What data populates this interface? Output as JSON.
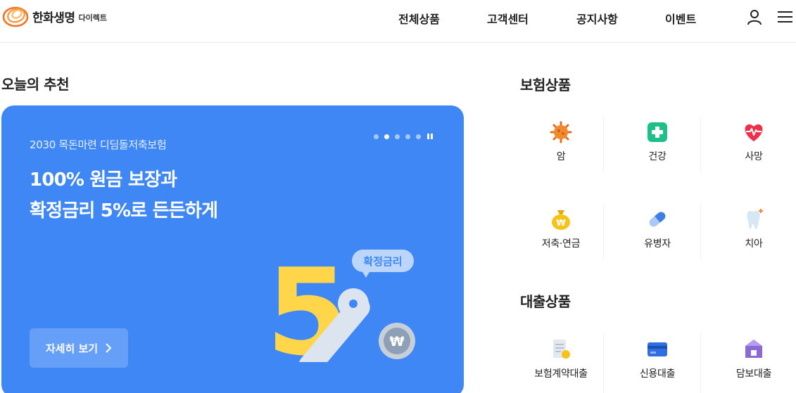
{
  "header": {
    "logo": {
      "name": "한화생명",
      "sub": "다이렉트"
    },
    "nav": [
      {
        "label": "전체상품"
      },
      {
        "label": "고객센터"
      },
      {
        "label": "공지사항"
      },
      {
        "label": "이벤트"
      }
    ],
    "icons": {
      "user": "user-icon",
      "menu": "hamburger-menu-icon"
    }
  },
  "recommend": {
    "title": "오늘의 추천",
    "banner": {
      "subtitle": "2030 목돈마련 디딤돌저축보험",
      "headline": "100% 원금 보장과\n확정금리 5%로 든든하게",
      "slides": {
        "total": 6,
        "active": 2
      },
      "promo": {
        "bubble": "확정금리",
        "number": "5",
        "percent": "%",
        "coin": "₩"
      },
      "cta": "자세히 보기",
      "color": "#3f87f5"
    }
  },
  "insurance": {
    "title": "보험상품",
    "items": [
      {
        "label": "암",
        "icon": "virus-icon"
      },
      {
        "label": "건강",
        "icon": "medical-cross-icon"
      },
      {
        "label": "사망",
        "icon": "heartbeat-icon"
      },
      {
        "label": "저축·연금",
        "icon": "money-bag-icon"
      },
      {
        "label": "유병자",
        "icon": "pill-capsule-icon"
      },
      {
        "label": "치아",
        "icon": "tooth-icon"
      }
    ]
  },
  "loan": {
    "title": "대출상품",
    "items": [
      {
        "label": "보험계약대출",
        "icon": "document-coin-icon"
      },
      {
        "label": "신용대출",
        "icon": "credit-card-icon"
      },
      {
        "label": "담보대출",
        "icon": "house-icon"
      }
    ]
  }
}
